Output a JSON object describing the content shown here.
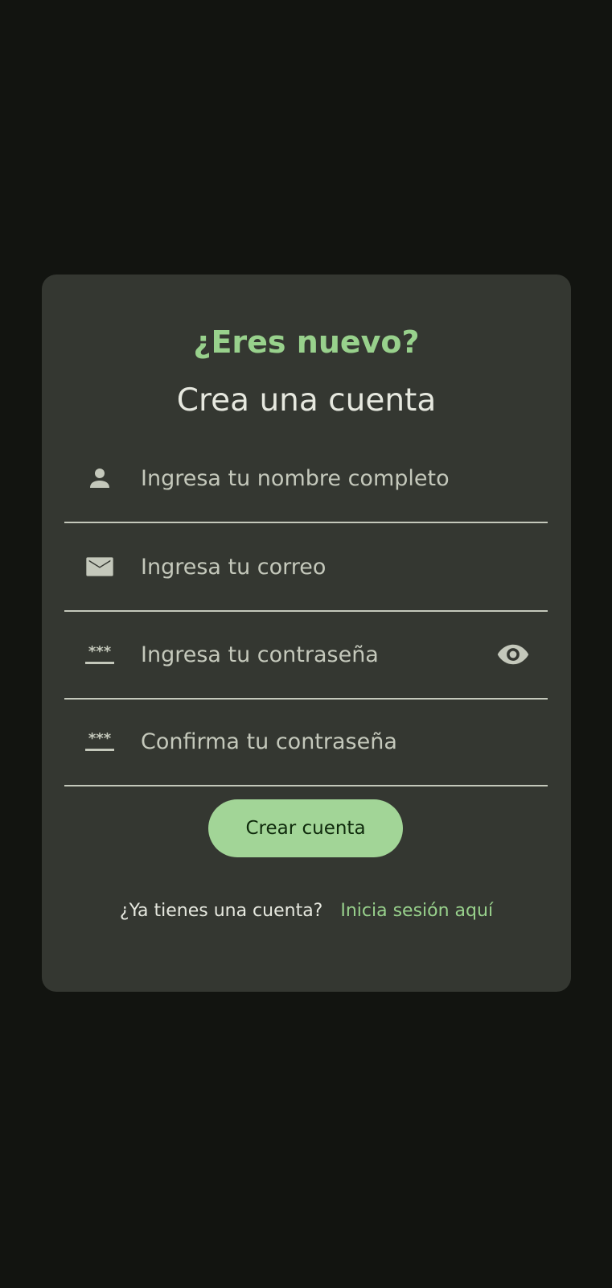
{
  "colors": {
    "background": "#121410",
    "card": "#343731",
    "accent": "#98d18c",
    "button": "#a2d597",
    "button_text": "#0f2a0c",
    "text": "#e6e8df",
    "muted": "#c4c8bb"
  },
  "header": {
    "eyebrow": "¿Eres nuevo?",
    "title": "Crea una cuenta"
  },
  "form": {
    "name": {
      "icon": "person-icon",
      "placeholder": "Ingresa tu nombre completo",
      "value": ""
    },
    "email": {
      "icon": "mail-icon",
      "placeholder": "Ingresa tu correo",
      "value": ""
    },
    "password": {
      "icon": "password-icon",
      "placeholder": "Ingresa tu contraseña",
      "value": "",
      "toggle_icon": "eye-icon"
    },
    "confirm_password": {
      "icon": "password-icon",
      "placeholder": "Confirma tu contraseña",
      "value": ""
    },
    "submit_label": "Crear cuenta"
  },
  "footer": {
    "question": "¿Ya tienes una cuenta?",
    "link": "Inicia sesión aquí"
  }
}
